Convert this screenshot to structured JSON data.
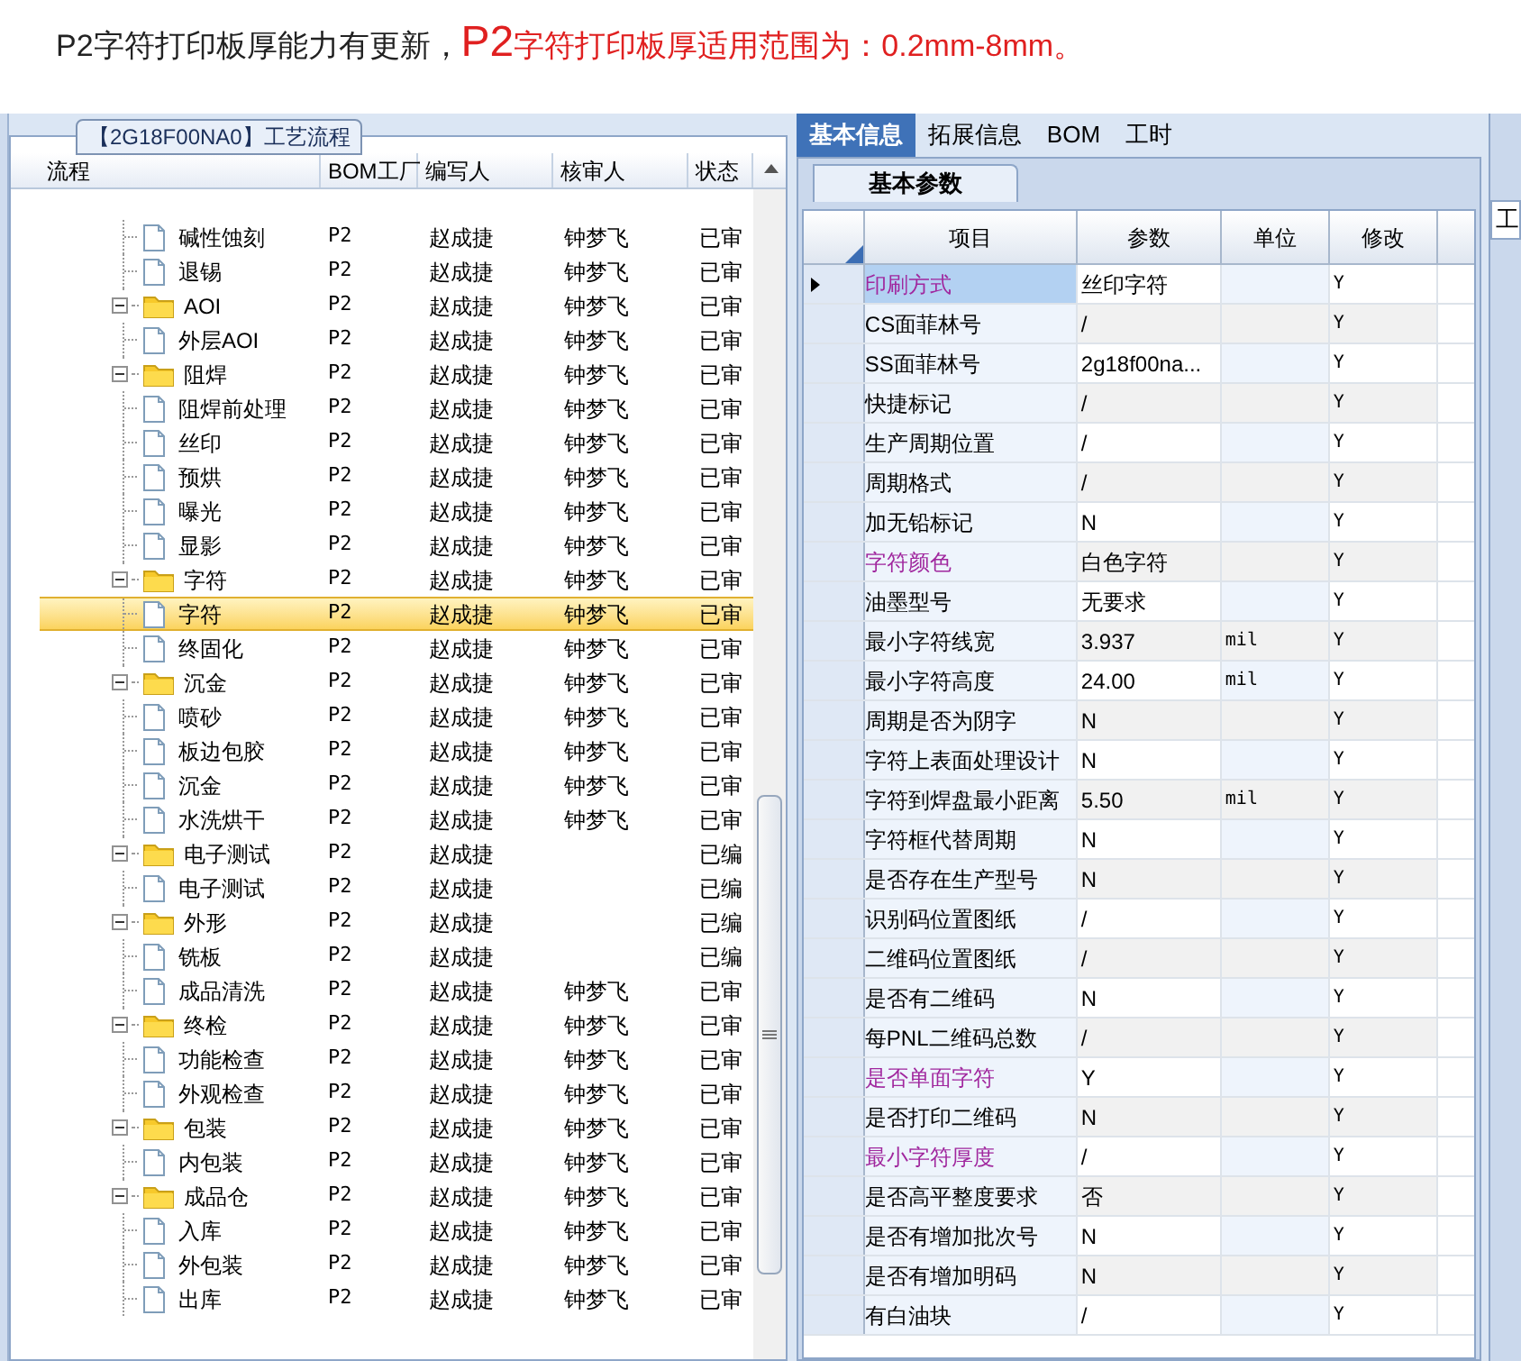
{
  "notice": {
    "text": "P2字符打印板厚能力有更新，",
    "highlight_prefix": "P2",
    "highlight_text": "字符打印板厚适用范围为：0.2mm-8mm。"
  },
  "left_panel": {
    "title": "【2G18F00NA0】工艺流程",
    "columns": [
      "流程",
      "BOM工厂",
      "编写人",
      "核审人",
      "状态"
    ],
    "tree": [
      {
        "kind": "file",
        "label": "碱性蚀刻",
        "bom": "P2",
        "writer": "赵成捷",
        "reviewer": "钟梦飞",
        "status": "已审",
        "selected": false
      },
      {
        "kind": "file",
        "label": "退锡",
        "bom": "P2",
        "writer": "赵成捷",
        "reviewer": "钟梦飞",
        "status": "已审",
        "selected": false
      },
      {
        "kind": "folder",
        "label": "AOI",
        "bom": "P2",
        "writer": "赵成捷",
        "reviewer": "钟梦飞",
        "status": "已审",
        "selected": false,
        "expanded": true,
        "children": [
          {
            "kind": "file",
            "label": "外层AOI",
            "bom": "P2",
            "writer": "赵成捷",
            "reviewer": "钟梦飞",
            "status": "已审",
            "selected": false
          }
        ]
      },
      {
        "kind": "folder",
        "label": "阻焊",
        "bom": "P2",
        "writer": "赵成捷",
        "reviewer": "钟梦飞",
        "status": "已审",
        "selected": false,
        "expanded": true,
        "children": [
          {
            "kind": "file",
            "label": "阻焊前处理",
            "bom": "P2",
            "writer": "赵成捷",
            "reviewer": "钟梦飞",
            "status": "已审",
            "selected": false
          },
          {
            "kind": "file",
            "label": "丝印",
            "bom": "P2",
            "writer": "赵成捷",
            "reviewer": "钟梦飞",
            "status": "已审",
            "selected": false
          },
          {
            "kind": "file",
            "label": "预烘",
            "bom": "P2",
            "writer": "赵成捷",
            "reviewer": "钟梦飞",
            "status": "已审",
            "selected": false
          },
          {
            "kind": "file",
            "label": "曝光",
            "bom": "P2",
            "writer": "赵成捷",
            "reviewer": "钟梦飞",
            "status": "已审",
            "selected": false
          },
          {
            "kind": "file",
            "label": "显影",
            "bom": "P2",
            "writer": "赵成捷",
            "reviewer": "钟梦飞",
            "status": "已审",
            "selected": false
          }
        ]
      },
      {
        "kind": "folder",
        "label": "字符",
        "bom": "P2",
        "writer": "赵成捷",
        "reviewer": "钟梦飞",
        "status": "已审",
        "selected": false,
        "expanded": true,
        "children": [
          {
            "kind": "file",
            "label": "字符",
            "bom": "P2",
            "writer": "赵成捷",
            "reviewer": "钟梦飞",
            "status": "已审",
            "selected": true
          },
          {
            "kind": "file",
            "label": "终固化",
            "bom": "P2",
            "writer": "赵成捷",
            "reviewer": "钟梦飞",
            "status": "已审",
            "selected": false
          }
        ]
      },
      {
        "kind": "folder",
        "label": "沉金",
        "bom": "P2",
        "writer": "赵成捷",
        "reviewer": "钟梦飞",
        "status": "已审",
        "selected": false,
        "expanded": true,
        "children": [
          {
            "kind": "file",
            "label": "喷砂",
            "bom": "P2",
            "writer": "赵成捷",
            "reviewer": "钟梦飞",
            "status": "已审",
            "selected": false
          },
          {
            "kind": "file",
            "label": "板边包胶",
            "bom": "P2",
            "writer": "赵成捷",
            "reviewer": "钟梦飞",
            "status": "已审",
            "selected": false
          },
          {
            "kind": "file",
            "label": "沉金",
            "bom": "P2",
            "writer": "赵成捷",
            "reviewer": "钟梦飞",
            "status": "已审",
            "selected": false
          },
          {
            "kind": "file",
            "label": "水洗烘干",
            "bom": "P2",
            "writer": "赵成捷",
            "reviewer": "钟梦飞",
            "status": "已审",
            "selected": false
          }
        ]
      },
      {
        "kind": "folder",
        "label": "电子测试",
        "bom": "P2",
        "writer": "赵成捷",
        "status": "已编",
        "selected": false,
        "expanded": true,
        "children": [
          {
            "kind": "file",
            "label": "电子测试",
            "bom": "P2",
            "writer": "赵成捷",
            "status": "已编",
            "selected": false
          }
        ]
      },
      {
        "kind": "folder",
        "label": "外形",
        "bom": "P2",
        "writer": "赵成捷",
        "status": "已编",
        "selected": false,
        "expanded": true,
        "children": [
          {
            "kind": "file",
            "label": "铣板",
            "bom": "P2",
            "writer": "赵成捷",
            "status": "已编",
            "selected": false
          },
          {
            "kind": "file",
            "label": "成品清洗",
            "bom": "P2",
            "writer": "赵成捷",
            "reviewer": "钟梦飞",
            "status": "已审",
            "selected": false
          }
        ]
      },
      {
        "kind": "folder",
        "label": "终检",
        "bom": "P2",
        "writer": "赵成捷",
        "reviewer": "钟梦飞",
        "status": "已审",
        "selected": false,
        "expanded": true,
        "children": [
          {
            "kind": "file",
            "label": "功能检查",
            "bom": "P2",
            "writer": "赵成捷",
            "reviewer": "钟梦飞",
            "status": "已审",
            "selected": false
          },
          {
            "kind": "file",
            "label": "外观检查",
            "bom": "P2",
            "writer": "赵成捷",
            "reviewer": "钟梦飞",
            "status": "已审",
            "selected": false
          }
        ]
      },
      {
        "kind": "folder",
        "label": "包装",
        "bom": "P2",
        "writer": "赵成捷",
        "reviewer": "钟梦飞",
        "status": "已审",
        "selected": false,
        "expanded": true,
        "children": [
          {
            "kind": "file",
            "label": "内包装",
            "bom": "P2",
            "writer": "赵成捷",
            "reviewer": "钟梦飞",
            "status": "已审",
            "selected": false
          }
        ]
      },
      {
        "kind": "folder",
        "label": "成品仓",
        "bom": "P2",
        "writer": "赵成捷",
        "reviewer": "钟梦飞",
        "status": "已审",
        "selected": false,
        "expanded": true,
        "children": [
          {
            "kind": "file",
            "label": "入库",
            "bom": "P2",
            "writer": "赵成捷",
            "reviewer": "钟梦飞",
            "status": "已审",
            "selected": false
          },
          {
            "kind": "file",
            "label": "外包装",
            "bom": "P2",
            "writer": "赵成捷",
            "reviewer": "钟梦飞",
            "status": "已审",
            "selected": false
          },
          {
            "kind": "file",
            "label": "出库",
            "bom": "P2",
            "writer": "赵成捷",
            "reviewer": "钟梦飞",
            "status": "已审",
            "selected": false
          }
        ]
      }
    ]
  },
  "right_panel": {
    "tabs": [
      {
        "label": "基本信息",
        "selected": true
      },
      {
        "label": "拓展信息",
        "selected": false
      },
      {
        "label": "BOM",
        "selected": false
      },
      {
        "label": "工时",
        "selected": false
      }
    ],
    "subtab": "基本参数",
    "columns": [
      "项目",
      "参数",
      "单位",
      "修改"
    ],
    "rows": [
      {
        "item": "印刷方式",
        "value": "丝印字符",
        "unit": "",
        "modify": "Y",
        "highlight": true,
        "selected": true
      },
      {
        "item": "CS面菲林号",
        "value": "/",
        "modify": "Y",
        "highlight": false,
        "selected": false
      },
      {
        "item": "SS面菲林号",
        "value": "2g18f00na...",
        "modify": "Y",
        "highlight": false,
        "selected": false
      },
      {
        "item": "快捷标记",
        "value": "/",
        "modify": "Y",
        "highlight": false,
        "selected": false
      },
      {
        "item": "生产周期位置",
        "value": "/",
        "modify": "Y",
        "highlight": false,
        "selected": false
      },
      {
        "item": "周期格式",
        "value": "/",
        "modify": "Y",
        "highlight": false,
        "selected": false
      },
      {
        "item": "加无铅标记",
        "value": "N",
        "modify": "Y",
        "highlight": false,
        "selected": false
      },
      {
        "item": "字符颜色",
        "value": "白色字符",
        "modify": "Y",
        "highlight": true,
        "selected": false
      },
      {
        "item": "油墨型号",
        "value": "无要求",
        "modify": "Y",
        "highlight": false,
        "selected": false
      },
      {
        "item": "最小字符线宽",
        "value": "3.937",
        "unit": "mil",
        "modify": "Y",
        "highlight": false,
        "selected": false
      },
      {
        "item": "最小字符高度",
        "value": "24.00",
        "unit": "mil",
        "modify": "Y",
        "highlight": false,
        "selected": false
      },
      {
        "item": "周期是否为阴字",
        "value": "N",
        "modify": "Y",
        "highlight": false,
        "selected": false
      },
      {
        "item": "字符上表面处理设计",
        "value": "N",
        "modify": "Y",
        "highlight": false,
        "selected": false
      },
      {
        "item": "字符到焊盘最小距离",
        "value": "5.50",
        "unit": "mil",
        "modify": "Y",
        "highlight": false,
        "selected": false
      },
      {
        "item": "字符框代替周期",
        "value": "N",
        "modify": "Y",
        "highlight": false,
        "selected": false
      },
      {
        "item": "是否存在生产型号",
        "value": "N",
        "modify": "Y",
        "highlight": false,
        "selected": false
      },
      {
        "item": "识别码位置图纸",
        "value": "/",
        "modify": "Y",
        "highlight": false,
        "selected": false
      },
      {
        "item": "二维码位置图纸",
        "value": "/",
        "modify": "Y",
        "highlight": false,
        "selected": false
      },
      {
        "item": "是否有二维码",
        "value": "N",
        "modify": "Y",
        "highlight": false,
        "selected": false
      },
      {
        "item": "每PNL二维码总数",
        "value": "/",
        "modify": "Y",
        "highlight": false,
        "selected": false
      },
      {
        "item": "是否单面字符",
        "value": "Y",
        "modify": "Y",
        "highlight": true,
        "selected": false
      },
      {
        "item": "是否打印二维码",
        "value": "N",
        "modify": "Y",
        "highlight": false,
        "selected": false
      },
      {
        "item": "最小字符厚度",
        "value": "/",
        "modify": "Y",
        "highlight": true,
        "selected": false
      },
      {
        "item": "是否高平整度要求",
        "value": "否",
        "modify": "Y",
        "highlight": false,
        "selected": false
      },
      {
        "item": "是否有增加批次号",
        "value": "N",
        "modify": "Y",
        "highlight": false,
        "selected": false
      },
      {
        "item": "是否有增加明码",
        "value": "N",
        "modify": "Y",
        "highlight": false,
        "selected": false
      },
      {
        "item": "有白油块",
        "value": "/",
        "modify": "Y",
        "highlight": false,
        "selected": false
      }
    ]
  },
  "side_panel": {
    "tab": "工"
  }
}
